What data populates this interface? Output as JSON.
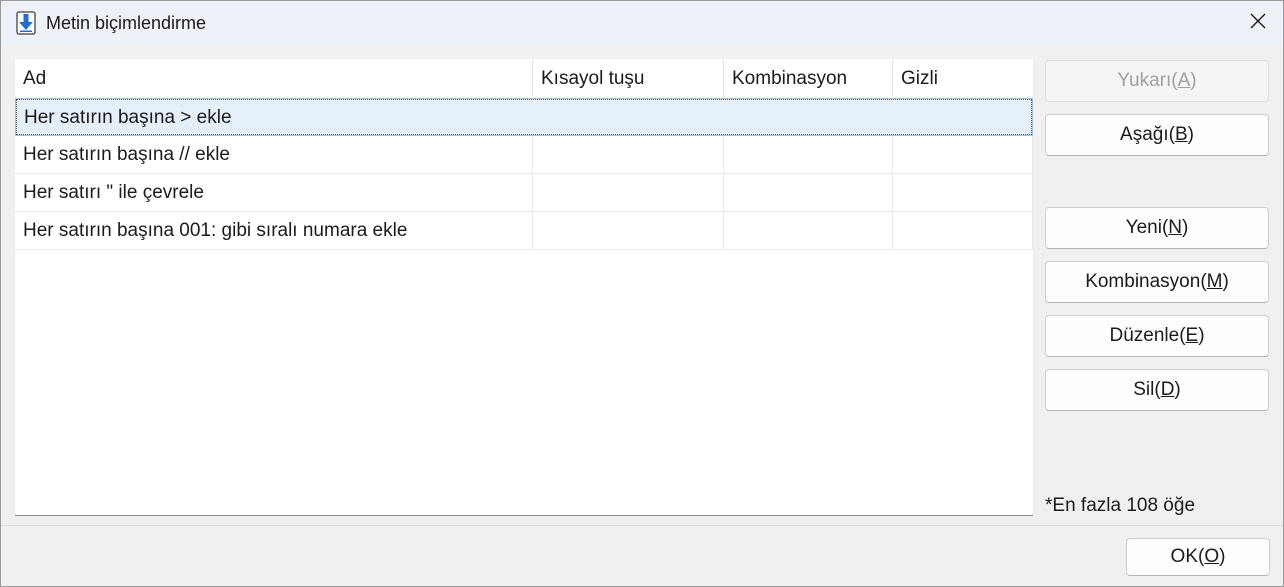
{
  "window": {
    "title": "Metin biçimlendirme"
  },
  "icons": {
    "app": "download-arrow-icon",
    "close": "close-icon"
  },
  "list": {
    "columns": [
      "Ad",
      "Kısayol tuşu",
      "Kombinasyon",
      "Gizli"
    ],
    "rows": [
      {
        "ad": "Her satırın başına > ekle",
        "kisayol": "",
        "kombinasyon": "",
        "gizli": "",
        "selected": true
      },
      {
        "ad": "Her satırın başına // ekle",
        "kisayol": "",
        "kombinasyon": "",
        "gizli": "",
        "selected": false
      },
      {
        "ad": "Her satırı \" ile çevrele",
        "kisayol": "",
        "kombinasyon": "",
        "gizli": "",
        "selected": false
      },
      {
        "ad": "Her satırın başına 001: gibi sıralı numara ekle",
        "kisayol": "",
        "kombinasyon": "",
        "gizli": "",
        "selected": false
      }
    ]
  },
  "buttons": {
    "up": {
      "label": "Yukarı",
      "key": "A",
      "enabled": false
    },
    "down": {
      "label": "Aşağı",
      "key": "B",
      "enabled": true
    },
    "new": {
      "label": "Yeni",
      "key": "N",
      "enabled": true
    },
    "combination": {
      "label": "Kombinasyon",
      "key": "M",
      "enabled": true
    },
    "edit": {
      "label": "Düzenle",
      "key": "E",
      "enabled": true
    },
    "delete": {
      "label": "Sil",
      "key": "D",
      "enabled": true
    },
    "ok": {
      "label": "OK",
      "key": "O",
      "enabled": true
    }
  },
  "note": "*En fazla 108 öğe",
  "colors": {
    "selection": "#e6f0fb",
    "titlebar": "#eef1f8",
    "icon_accent": "#1f6fd1"
  }
}
